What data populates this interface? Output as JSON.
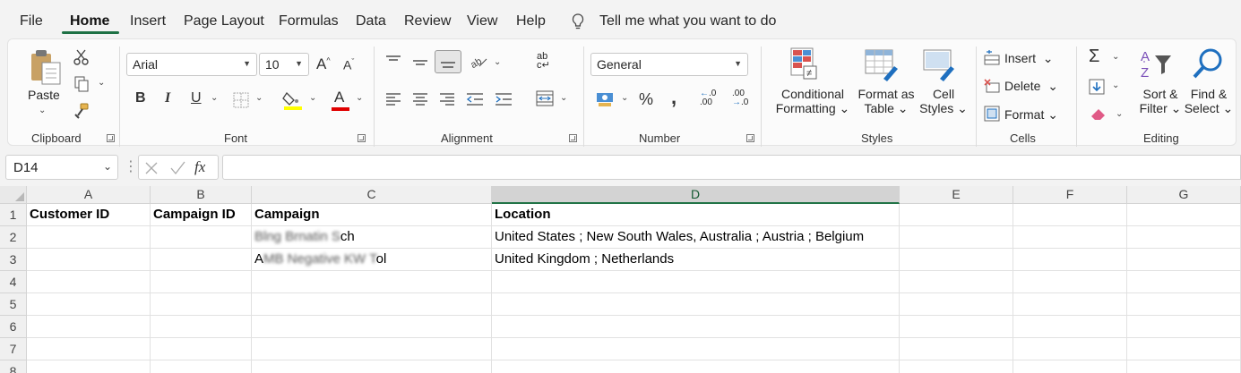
{
  "menu": {
    "items": [
      "File",
      "Home",
      "Insert",
      "Page Layout",
      "Formulas",
      "Data",
      "Review",
      "View",
      "Help"
    ],
    "active": "Home",
    "tell_me": "Tell me what you want to do"
  },
  "ribbon": {
    "clipboard": {
      "label": "Clipboard",
      "paste": "Paste"
    },
    "font": {
      "label": "Font",
      "name": "Arial",
      "size": "10",
      "bold": "B",
      "italic": "I",
      "underline": "U",
      "grow": "A",
      "shrink": "A",
      "color_letter": "A"
    },
    "alignment": {
      "label": "Alignment",
      "wrap_glyph": "ab"
    },
    "number": {
      "label": "Number",
      "format": "General",
      "percent": "%",
      "comma": ",",
      "inc_decimal": ".00",
      "dec_decimal": ".0"
    },
    "styles": {
      "label": "Styles",
      "conditional": [
        "Conditional",
        "Formatting"
      ],
      "format_table": [
        "Format as",
        "Table"
      ],
      "cell_styles": [
        "Cell",
        "Styles"
      ]
    },
    "cells": {
      "label": "Cells",
      "insert": "Insert",
      "delete": "Delete",
      "format": "Format"
    },
    "editing": {
      "label": "Editing",
      "sort": [
        "Sort &",
        "Filter"
      ],
      "find": [
        "Find &",
        "Select"
      ],
      "sigma": "Σ"
    }
  },
  "formula_bar": {
    "name_box": "D14",
    "fx": "fx",
    "value": ""
  },
  "sheet": {
    "columns": [
      "A",
      "B",
      "C",
      "D",
      "E",
      "F",
      "G"
    ],
    "selected_column": "D",
    "rows": [
      "1",
      "2",
      "3",
      "4",
      "5",
      "6",
      "7",
      "8"
    ],
    "header_row": [
      "Customer ID",
      "Campaign ID",
      "Campaign",
      "Location"
    ],
    "data": [
      {
        "campaign_prefix": "Blng Brnatin S",
        "campaign_visible": "ch",
        "location": "United States ; New South Wales, Australia ; Austria ; Belgium"
      },
      {
        "campaign_prefix_visible": "A",
        "campaign_blur": "MB Negative KW T",
        "campaign_visible": "ol",
        "location": "United Kingdom ; Netherlands"
      }
    ]
  },
  "colors": {
    "accent": "#217346",
    "excel_green": "#1e7145"
  }
}
